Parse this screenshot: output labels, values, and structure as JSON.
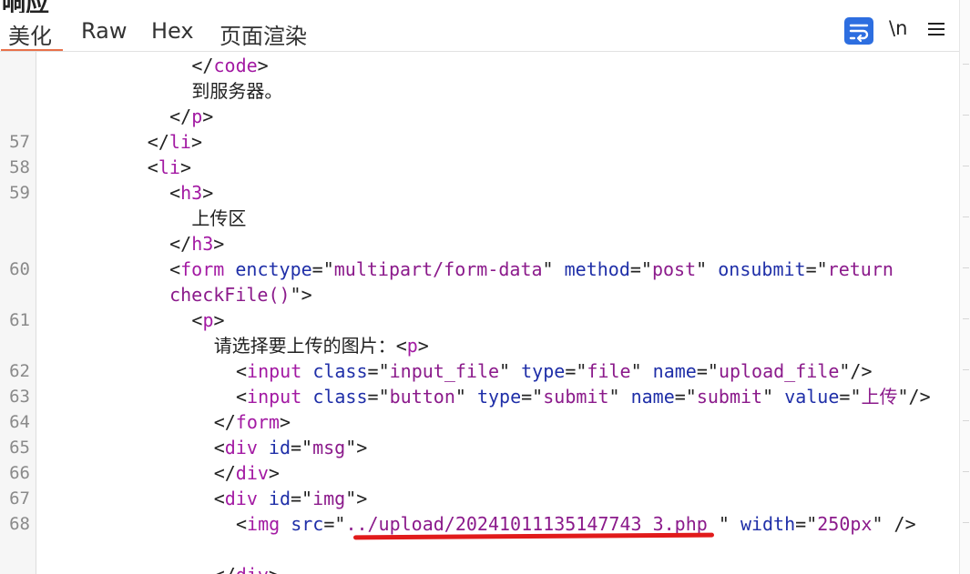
{
  "window_title": "响应",
  "tabs": [
    "美化",
    "Raw",
    "Hex",
    "页面渲染"
  ],
  "active_tab": "美化",
  "toolbar": {
    "wrap_icon": "wrap-lines-icon",
    "newline_label": "\\n",
    "menu_icon": "hamburger-menu-icon",
    "accent": "#2d6ee0"
  },
  "colors": {
    "tag": "#a31aa3",
    "attr": "#1f2fa8",
    "value": "#8b1a8b",
    "annotation": "#e11b1b",
    "tab_active": "#e8714a"
  },
  "lines": [
    {
      "ln": "",
      "indent": 8,
      "tokens": [
        [
          "p",
          "</"
        ],
        [
          "tg",
          "code"
        ],
        [
          "p",
          ">"
        ]
      ]
    },
    {
      "ln": "",
      "indent": 8,
      "tokens": [
        [
          "cn",
          "到服务器。"
        ]
      ]
    },
    {
      "ln": "",
      "indent": 7,
      "tokens": [
        [
          "p",
          "</"
        ],
        [
          "tg",
          "p"
        ],
        [
          "p",
          ">"
        ]
      ]
    },
    {
      "ln": "57",
      "indent": 6,
      "tokens": [
        [
          "p",
          "</"
        ],
        [
          "tg",
          "li"
        ],
        [
          "p",
          ">"
        ]
      ]
    },
    {
      "ln": "58",
      "indent": 6,
      "tokens": [
        [
          "p",
          "<"
        ],
        [
          "tg",
          "li"
        ],
        [
          "p",
          ">"
        ]
      ]
    },
    {
      "ln": "59",
      "indent": 7,
      "tokens": [
        [
          "p",
          "<"
        ],
        [
          "tg",
          "h3"
        ],
        [
          "p",
          ">"
        ]
      ]
    },
    {
      "ln": "",
      "indent": 8,
      "tokens": [
        [
          "cn",
          "上传区"
        ]
      ]
    },
    {
      "ln": "",
      "indent": 7,
      "tokens": [
        [
          "p",
          "</"
        ],
        [
          "tg",
          "h3"
        ],
        [
          "p",
          ">"
        ]
      ]
    },
    {
      "ln": "60",
      "indent": 7,
      "tokens": [
        [
          "p",
          "<"
        ],
        [
          "tg",
          "form"
        ],
        [
          "p",
          " "
        ],
        [
          "at",
          "enctype"
        ],
        [
          "p",
          "=\""
        ],
        [
          "vl",
          "multipart/form-data"
        ],
        [
          "p",
          "\" "
        ],
        [
          "at",
          "method"
        ],
        [
          "p",
          "=\""
        ],
        [
          "vl",
          "post"
        ],
        [
          "p",
          "\" "
        ],
        [
          "at",
          "onsubmit"
        ],
        [
          "p",
          "=\""
        ],
        [
          "vl",
          "return"
        ]
      ]
    },
    {
      "ln": "",
      "indent": 7,
      "tokens": [
        [
          "vl",
          "checkFile()"
        ],
        [
          "p",
          "\">"
        ]
      ]
    },
    {
      "ln": "61",
      "indent": 8,
      "tokens": [
        [
          "p",
          "<"
        ],
        [
          "tg",
          "p"
        ],
        [
          "p",
          ">"
        ]
      ]
    },
    {
      "ln": "",
      "indent": 9,
      "tokens": [
        [
          "cn",
          "请选择要上传的图片："
        ],
        [
          "p",
          "<"
        ],
        [
          "tg",
          "p"
        ],
        [
          "p",
          ">"
        ]
      ]
    },
    {
      "ln": "62",
      "indent": 10,
      "tokens": [
        [
          "p",
          "<"
        ],
        [
          "tg",
          "input"
        ],
        [
          "p",
          " "
        ],
        [
          "at",
          "class"
        ],
        [
          "p",
          "=\""
        ],
        [
          "vl",
          "input_file"
        ],
        [
          "p",
          "\" "
        ],
        [
          "at",
          "type"
        ],
        [
          "p",
          "=\""
        ],
        [
          "vl",
          "file"
        ],
        [
          "p",
          "\" "
        ],
        [
          "at",
          "name"
        ],
        [
          "p",
          "=\""
        ],
        [
          "vl",
          "upload_file"
        ],
        [
          "p",
          "\"/>"
        ]
      ]
    },
    {
      "ln": "63",
      "indent": 10,
      "tokens": [
        [
          "p",
          "<"
        ],
        [
          "tg",
          "input"
        ],
        [
          "p",
          " "
        ],
        [
          "at",
          "class"
        ],
        [
          "p",
          "=\""
        ],
        [
          "vl",
          "button"
        ],
        [
          "p",
          "\" "
        ],
        [
          "at",
          "type"
        ],
        [
          "p",
          "=\""
        ],
        [
          "vl",
          "submit"
        ],
        [
          "p",
          "\" "
        ],
        [
          "at",
          "name"
        ],
        [
          "p",
          "=\""
        ],
        [
          "vl",
          "submit"
        ],
        [
          "p",
          "\" "
        ],
        [
          "at",
          "value"
        ],
        [
          "p",
          "=\""
        ],
        [
          "vl",
          "上传"
        ],
        [
          "p",
          "\"/>"
        ]
      ]
    },
    {
      "ln": "64",
      "indent": 9,
      "tokens": [
        [
          "p",
          "</"
        ],
        [
          "tg",
          "form"
        ],
        [
          "p",
          ">"
        ]
      ]
    },
    {
      "ln": "65",
      "indent": 9,
      "tokens": [
        [
          "p",
          "<"
        ],
        [
          "tg",
          "div"
        ],
        [
          "p",
          " "
        ],
        [
          "at",
          "id"
        ],
        [
          "p",
          "=\""
        ],
        [
          "vl",
          "msg"
        ],
        [
          "p",
          "\">"
        ]
      ]
    },
    {
      "ln": "66",
      "indent": 9,
      "tokens": [
        [
          "p",
          "</"
        ],
        [
          "tg",
          "div"
        ],
        [
          "p",
          ">"
        ]
      ]
    },
    {
      "ln": "67",
      "indent": 9,
      "tokens": [
        [
          "p",
          "<"
        ],
        [
          "tg",
          "div"
        ],
        [
          "p",
          " "
        ],
        [
          "at",
          "id"
        ],
        [
          "p",
          "=\""
        ],
        [
          "vl",
          "img"
        ],
        [
          "p",
          "\">"
        ]
      ]
    },
    {
      "ln": "68",
      "indent": 10,
      "tokens": [
        [
          "p",
          "<"
        ],
        [
          "tg",
          "img"
        ],
        [
          "p",
          " "
        ],
        [
          "at",
          "src"
        ],
        [
          "p",
          "=\""
        ],
        [
          "vl",
          "../upload/20241011135147743 3.php "
        ],
        [
          "p",
          "\" "
        ],
        [
          "at",
          "width"
        ],
        [
          "p",
          "=\""
        ],
        [
          "vl",
          "250px"
        ],
        [
          "p",
          "\" />"
        ]
      ]
    },
    {
      "ln": "",
      "indent": 9,
      "tokens": []
    },
    {
      "ln": "",
      "indent": 9,
      "tokens": [
        [
          "p",
          "</"
        ],
        [
          "tg",
          "div"
        ],
        [
          "p",
          ">"
        ]
      ]
    }
  ]
}
